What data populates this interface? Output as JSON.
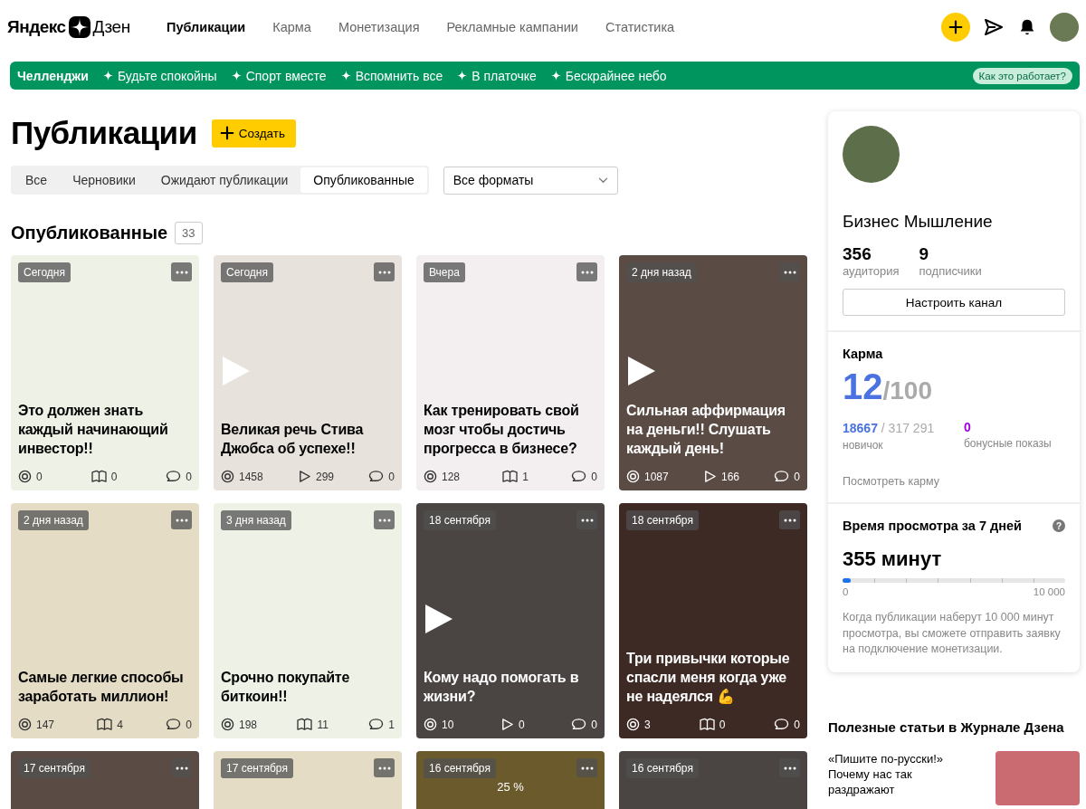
{
  "header": {
    "logo_text_1": "Яндекс",
    "logo_text_2": "Дзен",
    "nav": [
      {
        "label": "Публикации",
        "selected": true
      },
      {
        "label": "Карма",
        "selected": false
      },
      {
        "label": "Монетизация",
        "selected": false
      },
      {
        "label": "Рекламные кампании",
        "selected": false
      },
      {
        "label": "Статистика",
        "selected": false
      }
    ]
  },
  "challenges": {
    "title": "Челленджи",
    "items": [
      "Будьте спокойны",
      "Спорт вместе",
      "Вспомнить все",
      "В платочке",
      "Бескрайнее небо"
    ],
    "help": "Как это работает?"
  },
  "page": {
    "title": "Публикации",
    "create_button": "Создать",
    "filters": [
      {
        "label": "Все",
        "selected": false
      },
      {
        "label": "Черновики",
        "selected": false
      },
      {
        "label": "Ожидают публикации",
        "selected": false
      },
      {
        "label": "Опубликованные",
        "selected": true
      }
    ],
    "format_select": "Все форматы",
    "section_title": "Опубликованные",
    "count": "33"
  },
  "cards": [
    {
      "date": "Сегодня",
      "title": "Это должен знать каждый начинающий инвестор!!",
      "dark": false,
      "video": false,
      "stats": [
        {
          "kind": "views",
          "value": "0"
        },
        {
          "kind": "reads",
          "value": "0"
        },
        {
          "kind": "comments",
          "value": "0"
        }
      ]
    },
    {
      "date": "Сегодня",
      "title": "Великая речь Стива Джобса об успехе!!",
      "dark": false,
      "video": true,
      "stats": [
        {
          "kind": "views",
          "value": "1458"
        },
        {
          "kind": "plays",
          "value": "299"
        },
        {
          "kind": "comments",
          "value": "0"
        }
      ]
    },
    {
      "date": "Вчера",
      "title": "Как тренировать свой мозг чтобы достичь прогресса в бизнесе?",
      "dark": false,
      "video": false,
      "stats": [
        {
          "kind": "views",
          "value": "128"
        },
        {
          "kind": "reads",
          "value": "1"
        },
        {
          "kind": "comments",
          "value": "0"
        }
      ]
    },
    {
      "date": "2 дня назад",
      "title": "Сильная аффирмация на деньги!! Слушать каждый день!",
      "dark": true,
      "video": true,
      "stats": [
        {
          "kind": "views",
          "value": "1087"
        },
        {
          "kind": "plays",
          "value": "166"
        },
        {
          "kind": "comments",
          "value": "0"
        }
      ]
    },
    {
      "date": "2 дня назад",
      "title": "Самые легкие способы заработать миллион!",
      "dark": false,
      "video": false,
      "stats": [
        {
          "kind": "views",
          "value": "147"
        },
        {
          "kind": "reads",
          "value": "4"
        },
        {
          "kind": "comments",
          "value": "0"
        }
      ]
    },
    {
      "date": "3 дня назад",
      "title": "Срочно покупайте биткоин!!",
      "dark": false,
      "video": false,
      "stats": [
        {
          "kind": "views",
          "value": "198"
        },
        {
          "kind": "reads",
          "value": "11"
        },
        {
          "kind": "comments",
          "value": "1"
        }
      ]
    },
    {
      "date": "18 сентября",
      "title": "Кому надо помогать в жизни?",
      "dark": true,
      "video": true,
      "stats": [
        {
          "kind": "views",
          "value": "10"
        },
        {
          "kind": "plays",
          "value": "0"
        },
        {
          "kind": "comments",
          "value": "0"
        }
      ]
    },
    {
      "date": "18 сентября",
      "title": "Три привычки которые спасли меня когда уже не надеялся 💪",
      "dark": true,
      "video": false,
      "stats": [
        {
          "kind": "views",
          "value": "3"
        },
        {
          "kind": "reads",
          "value": "0"
        },
        {
          "kind": "comments",
          "value": "0"
        }
      ]
    },
    {
      "date": "17 сентября",
      "dark": true
    },
    {
      "date": "17 сентября",
      "dark": false
    },
    {
      "date": "16 сентября",
      "dark": true,
      "overlay_text": "25 %"
    },
    {
      "date": "16 сентября",
      "dark": true
    }
  ],
  "sidebar": {
    "channel_name": "Бизнес Мышление",
    "stats": [
      {
        "value": "356",
        "label": "аудитория"
      },
      {
        "value": "9",
        "label": "подписчики"
      }
    ],
    "settings_button": "Настроить канал",
    "karma": {
      "title": "Карма",
      "score": "12",
      "max": "/100",
      "points": "18667",
      "points_total": " / 317 291",
      "level_label": "новичок",
      "bonus": "0",
      "bonus_label": "бонусные показы",
      "link": "Посмотреть карму"
    },
    "watch": {
      "title": "Время просмотра за 7 дней",
      "help": "?",
      "value": "355 минут",
      "level": 0.0355,
      "min": "0",
      "max": "10 000",
      "note": "Когда публикации наберут 10 000 минут просмотра, вы сможете отправить заявку на подключение монетизации."
    },
    "articles": {
      "title": "Полезные статьи в Журнале Дзена",
      "items": [
        {
          "text": "«Пишите по-русски!» Почему нас так раздражают"
        }
      ]
    }
  }
}
